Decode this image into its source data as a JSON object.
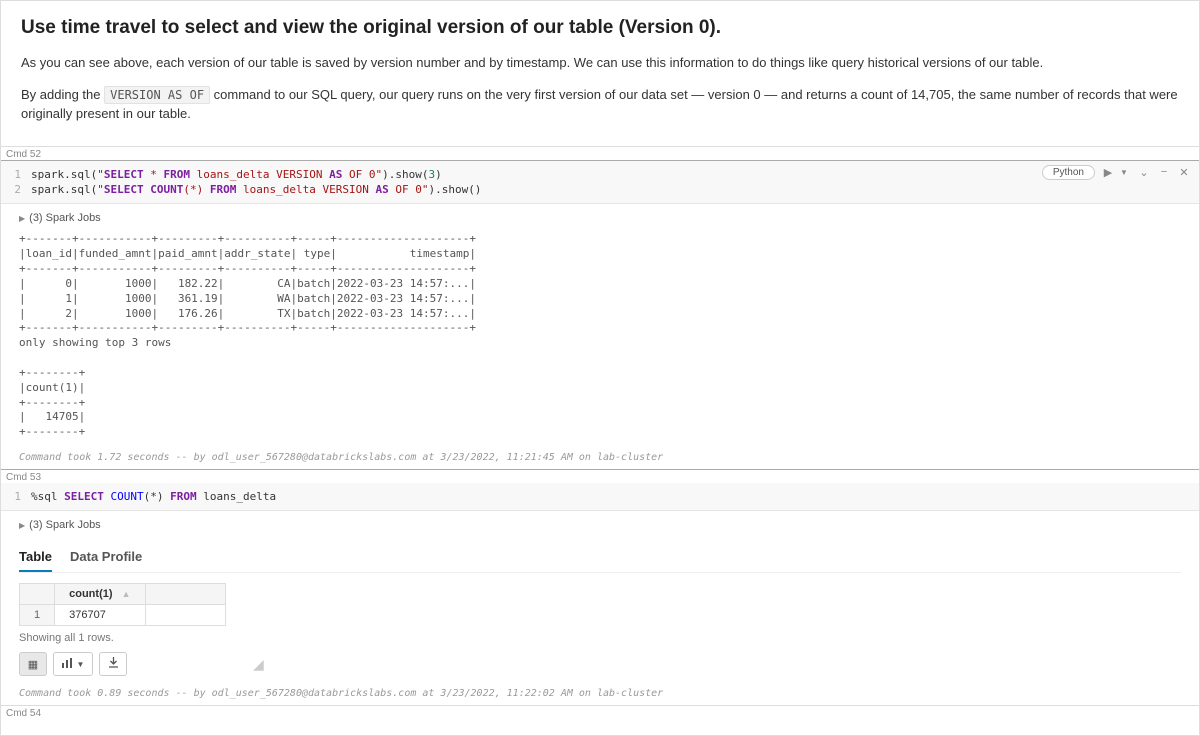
{
  "markdown": {
    "heading": "Use time travel to select and view the original version of our table (Version 0).",
    "para1": "As you can see above, each version of our table is saved by version number and by timestamp. We can use this information to do things like query historical versions of our table.",
    "para2_pre": "By adding the ",
    "para2_code": "VERSION AS OF",
    "para2_post": " command to our SQL query, our query runs on the very first version of our data set — version 0 — and returns a count of 14,705, the same number of records that were originally present in our table."
  },
  "cmd52": {
    "label": "Cmd 52",
    "lang": "Python",
    "code": {
      "line1_num": "1",
      "line2_num": "2",
      "spark": "spark",
      "sql_call": ".sql(",
      "q1_open": "\"",
      "q1_select": "SELECT",
      "q1_star": " * ",
      "q1_from": "FROM",
      "q1_mid": " loans_delta VERSION ",
      "q1_as": "AS",
      "q1_of": " OF ",
      "q1_zero": "0",
      "q1_close": "\"",
      "show3": ").show(",
      "three": "3",
      "rparen": ")",
      "q2_select": "SELECT",
      "q2_count": " COUNT",
      "q2_star": "(*) ",
      "q2_from": "FROM",
      "q2_mid": " loans_delta VERSION ",
      "q2_as": "AS",
      "q2_of": " OF ",
      "q2_zero": "0",
      "show0": ").show()"
    },
    "spark_jobs": "(3) Spark Jobs",
    "output": "+-------+-----------+---------+----------+-----+--------------------+\n|loan_id|funded_amnt|paid_amnt|addr_state| type|           timestamp|\n+-------+-----------+---------+----------+-----+--------------------+\n|      0|       1000|   182.22|        CA|batch|2022-03-23 14:57:...|\n|      1|       1000|   361.19|        WA|batch|2022-03-23 14:57:...|\n|      2|       1000|   176.26|        TX|batch|2022-03-23 14:57:...|\n+-------+-----------+---------+----------+-----+--------------------+\nonly showing top 3 rows\n\n+--------+\n|count(1)|\n+--------+\n|   14705|\n+--------+",
    "footer": "Command took 1.72 seconds -- by odl_user_567280@databrickslabs.com at 3/23/2022, 11:21:45 AM on lab-cluster"
  },
  "cmd53": {
    "label": "Cmd 53",
    "code": {
      "line1_num": "1",
      "magic": "%sql ",
      "select": "SELECT",
      "count": " COUNT",
      "star": "(*) ",
      "from": "FROM",
      "table": " loans_delta"
    },
    "spark_jobs": "(3) Spark Jobs",
    "tabs": {
      "table": "Table",
      "profile": "Data Profile"
    },
    "result": {
      "col_header": "count(1)",
      "row_idx": "1",
      "value": "376707",
      "showing": "Showing all 1 rows."
    },
    "footer": "Command took 0.89 seconds -- by odl_user_567280@databrickslabs.com at 3/23/2022, 11:22:02 AM on lab-cluster"
  },
  "cmd54": {
    "label": "Cmd 54"
  },
  "chart_data": {
    "type": "table",
    "title": "loans_delta VERSION AS OF 0 (top 3 rows)",
    "columns": [
      "loan_id",
      "funded_amnt",
      "paid_amnt",
      "addr_state",
      "type",
      "timestamp"
    ],
    "rows": [
      [
        0,
        1000,
        182.22,
        "CA",
        "batch",
        "2022-03-23 14:57:..."
      ],
      [
        1,
        1000,
        361.19,
        "WA",
        "batch",
        "2022-03-23 14:57:..."
      ],
      [
        2,
        1000,
        176.26,
        "TX",
        "batch",
        "2022-03-23 14:57:..."
      ]
    ],
    "counts": {
      "version_0_count": 14705,
      "current_count": 376707
    }
  }
}
